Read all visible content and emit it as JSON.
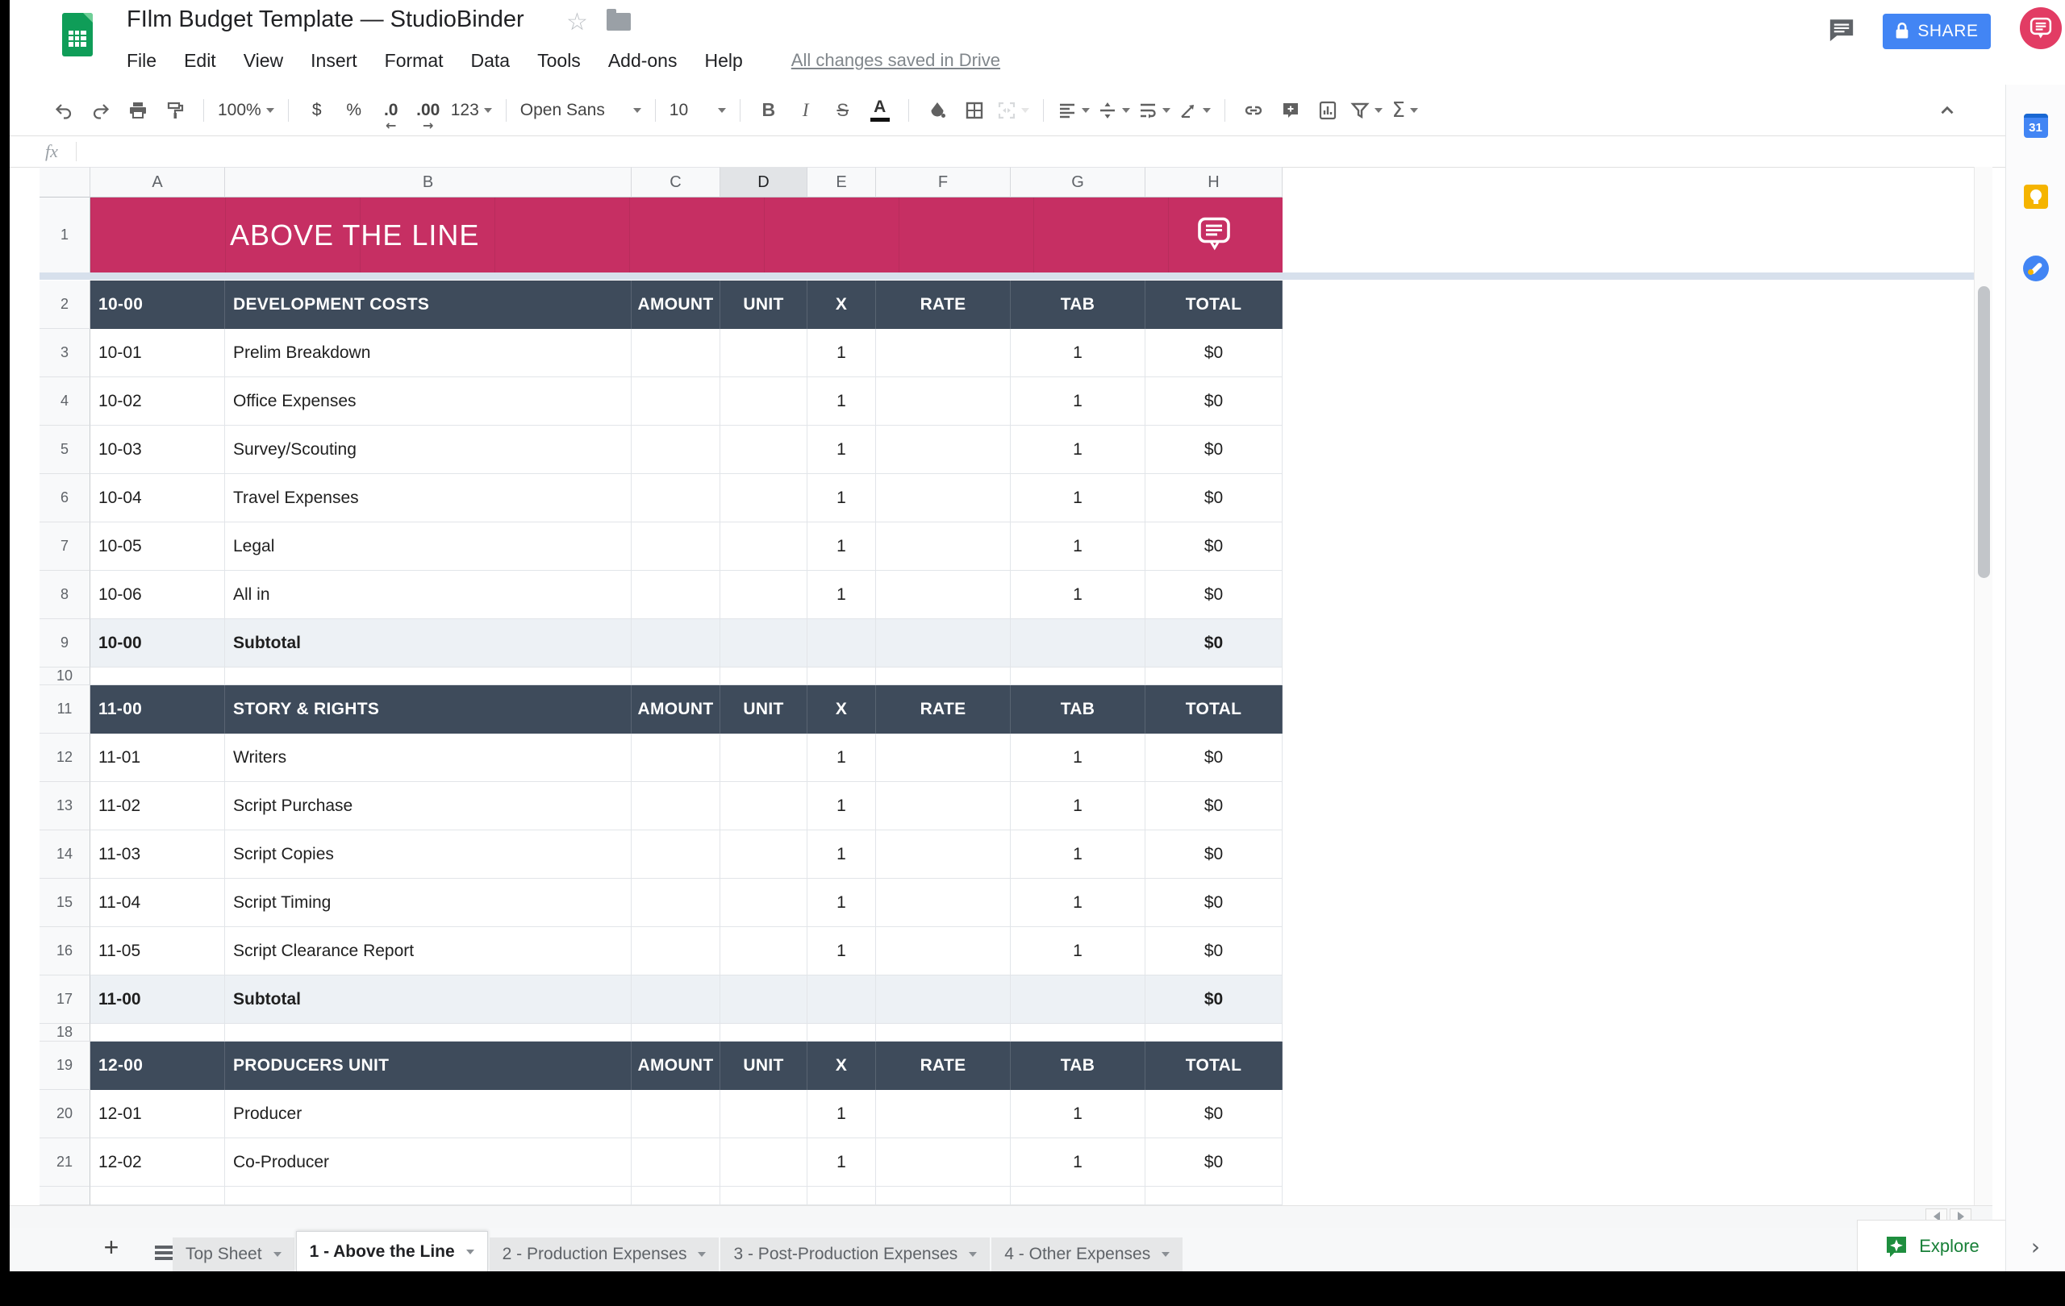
{
  "titlebar": {
    "title": "FIlm Budget Template — StudioBinder",
    "save_status": "All changes saved in Drive",
    "share_label": "SHARE",
    "menus": [
      "File",
      "Edit",
      "View",
      "Insert",
      "Format",
      "Data",
      "Tools",
      "Add-ons",
      "Help"
    ]
  },
  "toolbar": {
    "zoom": "100%",
    "currency": "$",
    "percent": "%",
    "decrease_decimal": ".0",
    "increase_decimal": ".00",
    "number_format": "123",
    "font_name": "Open Sans",
    "font_size": "10",
    "bold_label": "B",
    "italic_label": "I",
    "strike_label": "S",
    "text_color_label": "A",
    "functions_label": "Σ"
  },
  "formula_bar": {
    "fx_label": "fx"
  },
  "grid": {
    "column_letters": [
      "A",
      "B",
      "C",
      "D",
      "E",
      "F",
      "G",
      "H"
    ],
    "selected_column": "D",
    "table_headers": [
      "AMOUNT",
      "UNIT",
      "X",
      "RATE",
      "TAB",
      "TOTAL"
    ],
    "rows": [
      {
        "n": "1",
        "type": "banner",
        "b": "ABOVE THE LINE"
      },
      {
        "n": "2",
        "type": "section",
        "a": "10-00",
        "b": "DEVELOPMENT COSTS"
      },
      {
        "n": "3",
        "type": "item",
        "a": "10-01",
        "b": "Prelim Breakdown",
        "x": "1",
        "tab": "1",
        "total": "$0"
      },
      {
        "n": "4",
        "type": "item",
        "a": "10-02",
        "b": "Office Expenses",
        "x": "1",
        "tab": "1",
        "total": "$0"
      },
      {
        "n": "5",
        "type": "item",
        "a": "10-03",
        "b": "Survey/Scouting",
        "x": "1",
        "tab": "1",
        "total": "$0"
      },
      {
        "n": "6",
        "type": "item",
        "a": "10-04",
        "b": "Travel Expenses",
        "x": "1",
        "tab": "1",
        "total": "$0"
      },
      {
        "n": "7",
        "type": "item",
        "a": "10-05",
        "b": "Legal",
        "x": "1",
        "tab": "1",
        "total": "$0"
      },
      {
        "n": "8",
        "type": "item",
        "a": "10-06",
        "b": "All in",
        "x": "1",
        "tab": "1",
        "total": "$0"
      },
      {
        "n": "9",
        "type": "subtotal",
        "a": "10-00",
        "b": "Subtotal",
        "total": "$0"
      },
      {
        "n": "10",
        "type": "spacer"
      },
      {
        "n": "11",
        "type": "section",
        "a": "11-00",
        "b": "STORY & RIGHTS"
      },
      {
        "n": "12",
        "type": "item",
        "a": "11-01",
        "b": "Writers",
        "x": "1",
        "tab": "1",
        "total": "$0"
      },
      {
        "n": "13",
        "type": "item",
        "a": "11-02",
        "b": "Script Purchase",
        "x": "1",
        "tab": "1",
        "total": "$0"
      },
      {
        "n": "14",
        "type": "item",
        "a": "11-03",
        "b": "Script Copies",
        "x": "1",
        "tab": "1",
        "total": "$0"
      },
      {
        "n": "15",
        "type": "item",
        "a": "11-04",
        "b": "Script Timing",
        "x": "1",
        "tab": "1",
        "total": "$0"
      },
      {
        "n": "16",
        "type": "item",
        "a": "11-05",
        "b": "Script Clearance Report",
        "x": "1",
        "tab": "1",
        "total": "$0"
      },
      {
        "n": "17",
        "type": "subtotal",
        "a": "11-00",
        "b": "Subtotal",
        "total": "$0"
      },
      {
        "n": "18",
        "type": "spacer"
      },
      {
        "n": "19",
        "type": "section",
        "a": "12-00",
        "b": "PRODUCERS UNIT"
      },
      {
        "n": "20",
        "type": "item",
        "a": "12-01",
        "b": "Producer",
        "x": "1",
        "tab": "1",
        "total": "$0"
      },
      {
        "n": "21",
        "type": "item",
        "a": "12-02",
        "b": "Co-Producer",
        "x": "1",
        "tab": "1",
        "total": "$0"
      },
      {
        "n": "",
        "type": "partial"
      }
    ]
  },
  "sheet_tabs": {
    "tabs": [
      {
        "label": "Top Sheet",
        "active": false
      },
      {
        "label": "1 - Above the Line",
        "active": true
      },
      {
        "label": "2 - Production Expenses",
        "active": false
      },
      {
        "label": "3 - Post-Production Expenses",
        "active": false
      },
      {
        "label": "4 - Other Expenses",
        "active": false
      }
    ],
    "explore_label": "Explore"
  },
  "side_panel": {
    "calendar_label": "31"
  },
  "colors": {
    "banner_pink": "#C62F63",
    "header_slate": "#3E4B5B",
    "subtotal_bg": "#EDF1F5",
    "share_blue": "#4285F4",
    "sheets_green": "#0F9D58",
    "explore_green": "#188038",
    "avatar_pink": "#E23C64"
  }
}
